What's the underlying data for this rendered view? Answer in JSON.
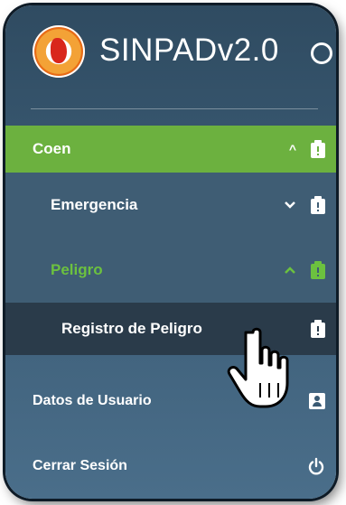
{
  "header": {
    "app_title": "SINPADv2.0",
    "logo_icon": "sinpad-logo",
    "status_icon": "status-circle-icon"
  },
  "menu": {
    "coen": {
      "label": "Coen",
      "expanded": true,
      "accent": "#6cb13f"
    },
    "emergencia": {
      "label": "Emergencia",
      "expanded": false
    },
    "peligro": {
      "label": "Peligro",
      "expanded": true,
      "accent": "#6cc13f"
    },
    "registro": {
      "label": "Registro de Peligro"
    },
    "datos_usuario": {
      "label": "Datos de Usuario",
      "icon": "user-card-icon"
    },
    "cerrar_sesion": {
      "label": "Cerrar Sesión",
      "icon": "power-icon"
    }
  },
  "cursor": {
    "icon": "hand-pointer-cursor"
  }
}
